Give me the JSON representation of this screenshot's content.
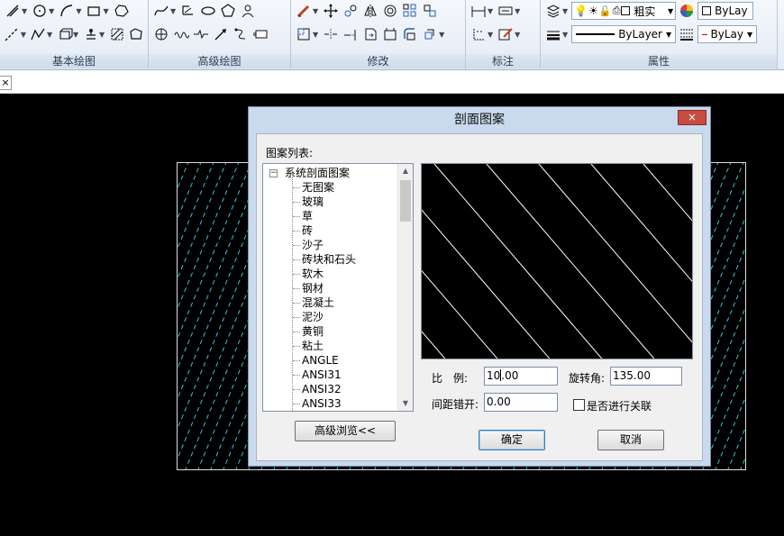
{
  "ribbon": {
    "panels": [
      {
        "title": "基本绘图"
      },
      {
        "title": "高级绘图"
      },
      {
        "title": "修改"
      },
      {
        "title": "标注"
      },
      {
        "title": "属性"
      }
    ],
    "properties": {
      "lineweight_label": "粗实",
      "linetype_value": "ByLayer",
      "color_value_top": "ByLay",
      "color_value_bottom": "ByLay"
    }
  },
  "document_tab": {
    "close_glyph": "×"
  },
  "dialog": {
    "title": "剖面图案",
    "close_glyph": "×",
    "pattern_list_label": "图案列表:",
    "tree": {
      "root": "系统剖面图案",
      "expander": "−",
      "items": [
        "无图案",
        "玻璃",
        "草",
        "砖",
        "沙子",
        "砖块和石头",
        "软木",
        "钢材",
        "混凝土",
        "泥沙",
        "黄铜",
        "粘土",
        "ANGLE",
        "ANSI31",
        "ANSI32",
        "ANSI33"
      ]
    },
    "advanced_browse_button": "高级浏览<<",
    "scale_label": "比　例:",
    "scale_value": "10.00",
    "rotation_label": "旋转角:",
    "rotation_value": "135.00",
    "spacing_offset_label": "间距错开:",
    "spacing_offset_value": "0.00",
    "associate_label": "是否进行关联",
    "associate_checked": false,
    "ok_button": "确定",
    "cancel_button": "取消"
  },
  "colors": {
    "hatch_line": "#2fc9d0",
    "close_button": "#c84b3f",
    "dialog_frame": "#c9d9ee"
  },
  "icons": [
    "line-icon",
    "circle-icon",
    "arc-icon",
    "rectangle-icon",
    "polyline-icon",
    "hatch-icon",
    "spline-icon",
    "ellipse-icon",
    "polygon-icon",
    "move-icon",
    "mirror-icon",
    "array-icon",
    "trim-icon",
    "dimension-icon",
    "properties-icon"
  ]
}
